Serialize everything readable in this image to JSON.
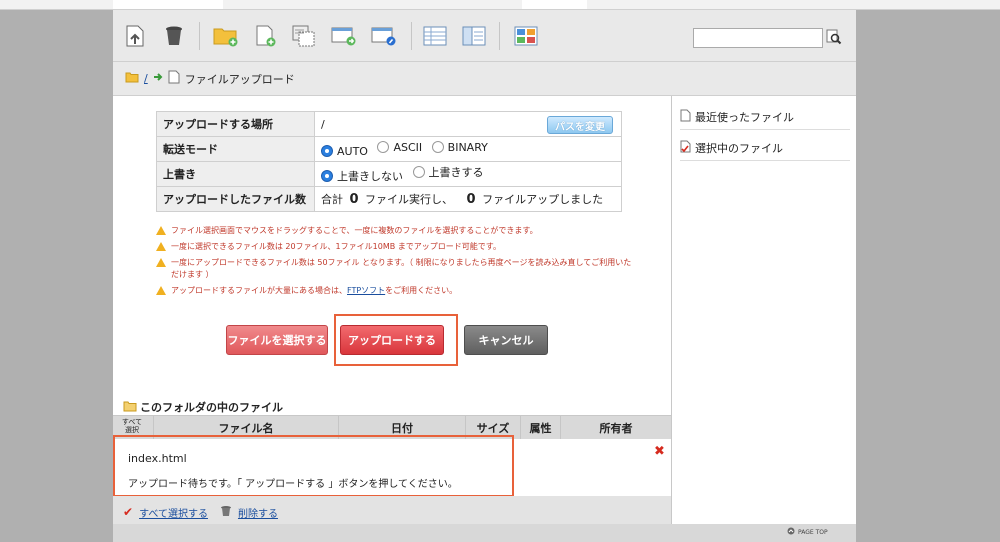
{
  "toolbar": {
    "search": {
      "value": ""
    }
  },
  "breadcrumb": {
    "root": "/",
    "current": "ファイルアップロード"
  },
  "upload_table": {
    "location_label": "アップロードする場所",
    "location_value": "/",
    "change_path_button": "パスを変更",
    "mode_label": "転送モード",
    "mode_options": [
      "AUTO",
      "ASCII",
      "BINARY"
    ],
    "mode_selected": "AUTO",
    "overwrite_label": "上書き",
    "overwrite_options": [
      "上書きしない",
      "上書きする"
    ],
    "overwrite_selected": "上書きしない",
    "count_label": "アップロードしたファイル数",
    "count_prefix": "合計",
    "count_exec": "0",
    "count_exec_suffix": "ファイル実行し、",
    "count_uploaded": "0",
    "count_uploaded_suffix": "ファイルアップしました"
  },
  "notes": [
    "ファイル選択画面でマウスをドラッグすることで、一度に複数のファイルを選択することができます。",
    "一度に選択できるファイル数は 20ファイル、1ファイル10MB までアップロード可能です。",
    "一度にアップロードできるファイル数は 50ファイル となります。（ 制限になりましたら再度ページを読み込み直してご利用いただけます ）"
  ],
  "note_ftp": {
    "prefix": "アップロードするファイルが大量にある場合は、",
    "link": "FTPソフト",
    "suffix": "をご利用ください。"
  },
  "buttons": {
    "select_files": "ファイルを選択する",
    "upload": "アップロードする",
    "cancel": "キャンセル"
  },
  "file_list": {
    "title": "このフォルダの中のファイル",
    "select_all_header": "すべて選択",
    "columns": [
      "ファイル名",
      "日付",
      "サイズ",
      "属性",
      "所有者"
    ],
    "row": {
      "name": "index.html",
      "status": "アップロード待ちです。「 アップロードする 」ボタンを押してください。"
    },
    "select_all_link": "すべて選択する",
    "delete_link": "削除する"
  },
  "right_panel": {
    "recent": "最近使ったファイル",
    "selected": "選択中のファイル"
  },
  "footer": {
    "page_top": "PAGE TOP"
  },
  "colors": {
    "select_button": "#e8676a",
    "upload_button": "#e34c52",
    "cancel_button": "#6f6f6f",
    "highlight": "#e8613a"
  },
  "icons": [
    "upload-arrow-icon",
    "trash-icon",
    "new-folder-icon",
    "new-file-icon",
    "copy-icon",
    "move-icon",
    "rename-icon",
    "list-view-icon",
    "detail-view-icon",
    "thumbnail-view-icon",
    "search-icon",
    "folder-icon",
    "arrow-right-icon",
    "file-icon",
    "warning-icon",
    "checkmark-icon",
    "page-top-icon"
  ]
}
